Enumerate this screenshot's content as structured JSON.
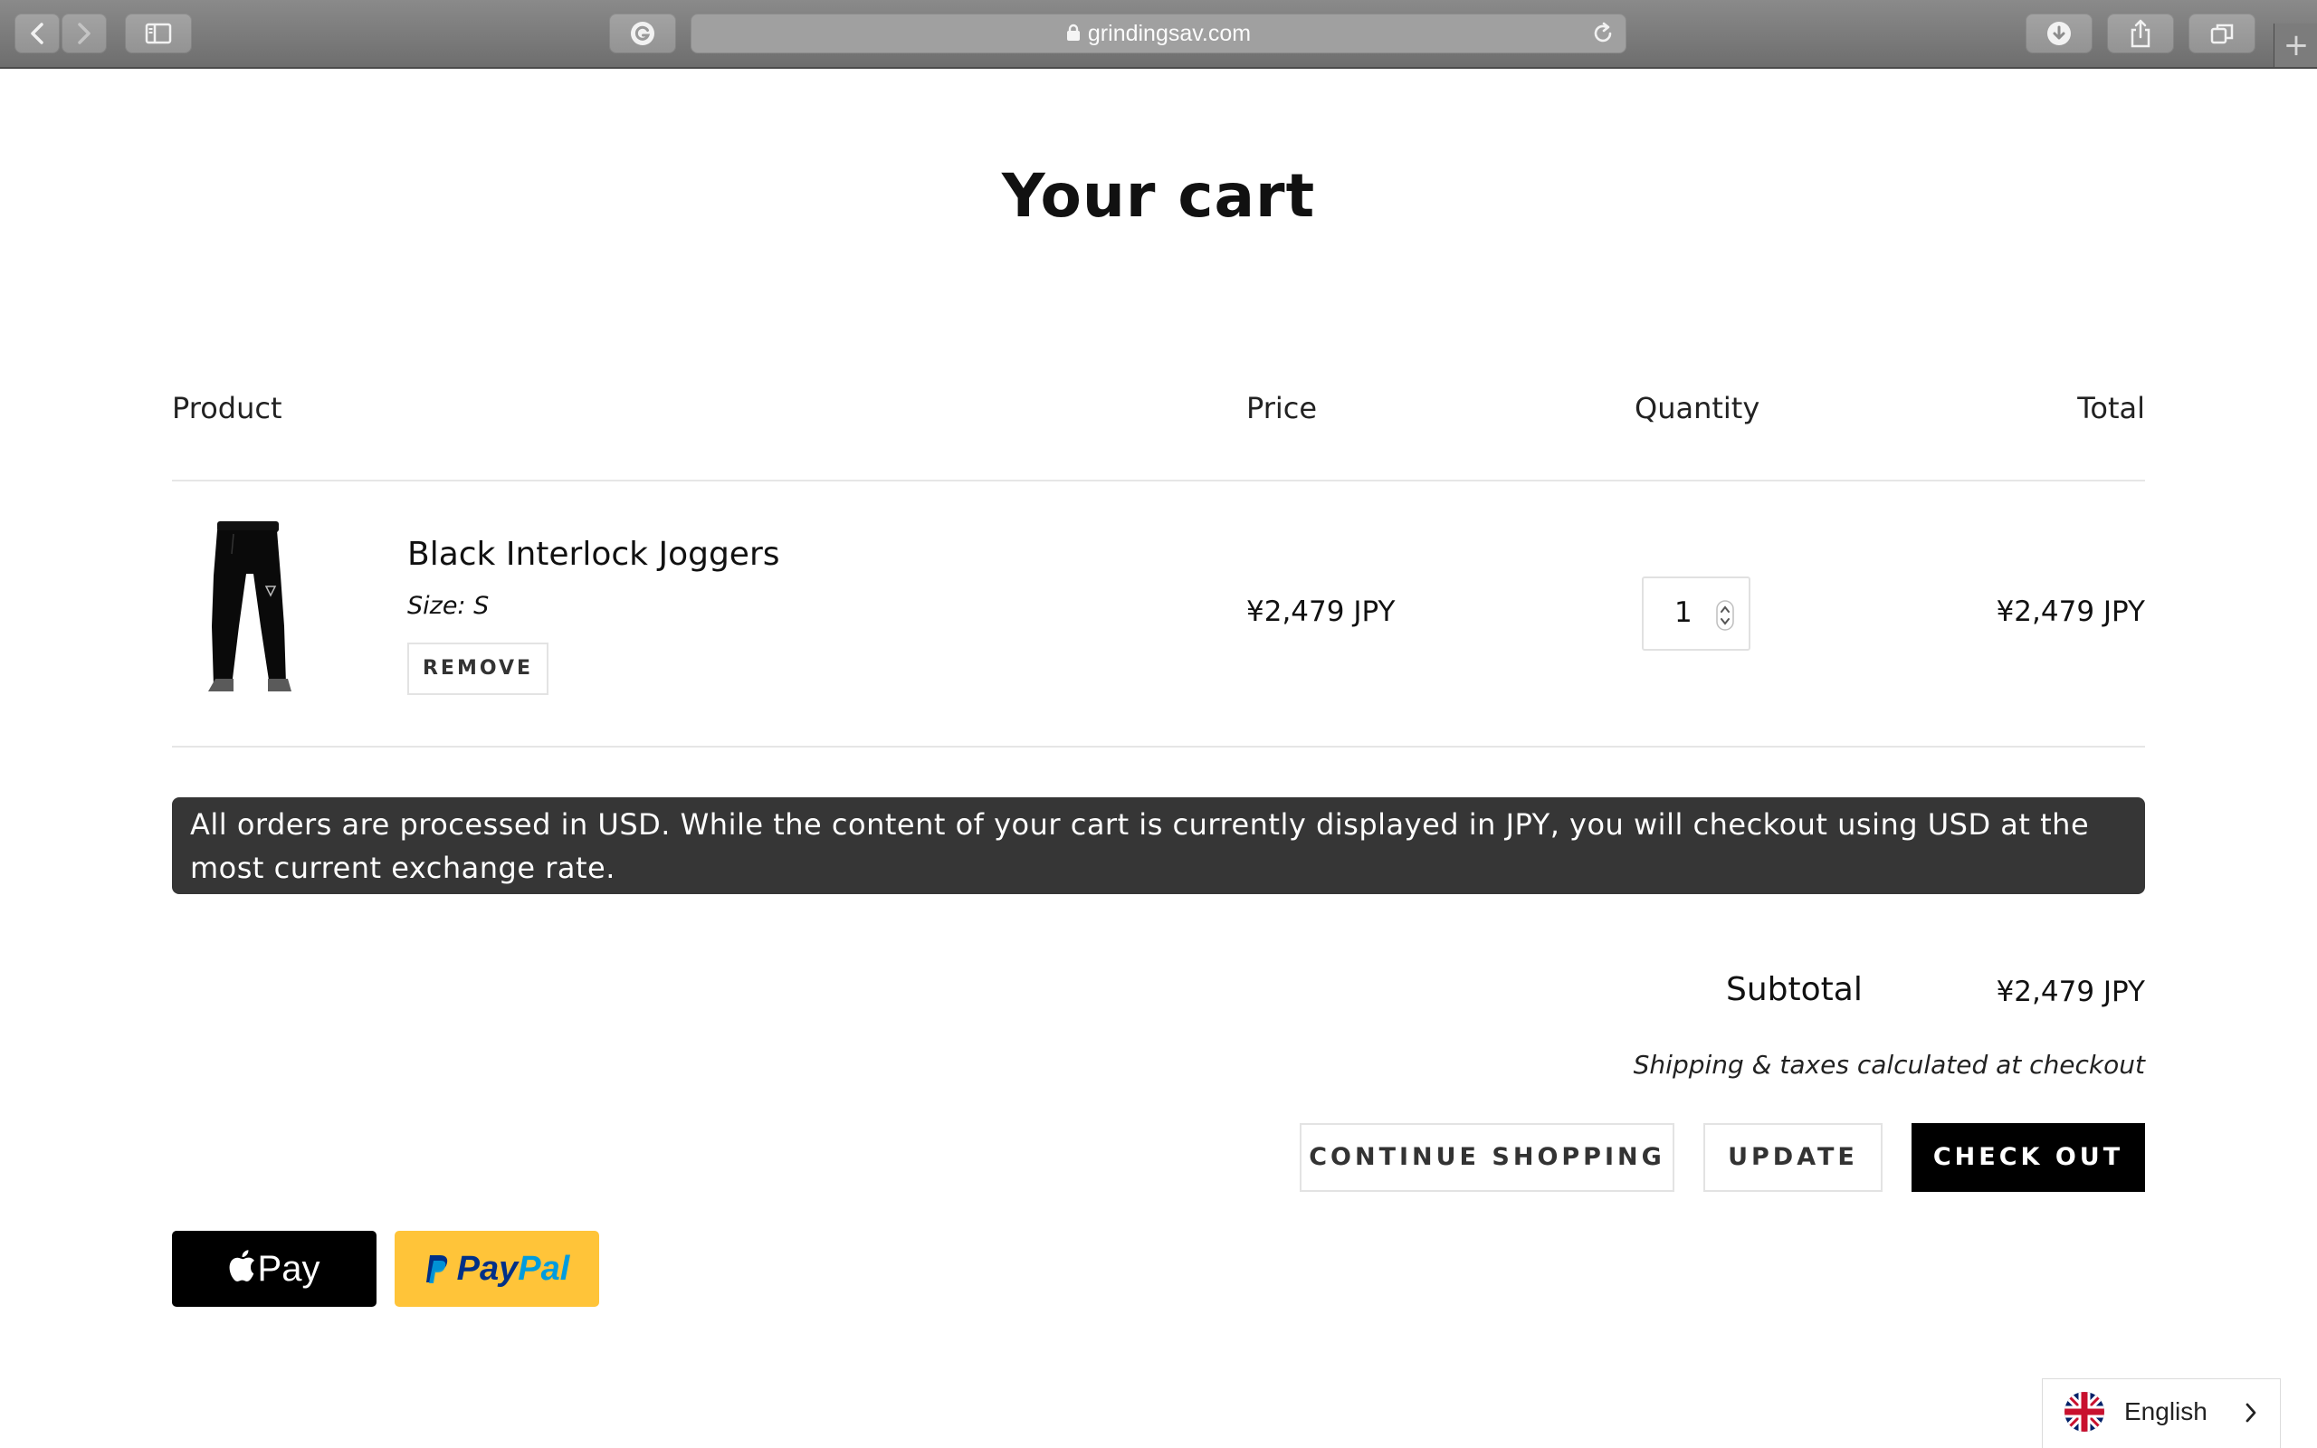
{
  "browser": {
    "url": "grindingsav.com",
    "grammarly_icon": "grammarly-icon",
    "new_tab_glyph": "+"
  },
  "page": {
    "title": "Your cart"
  },
  "table": {
    "headers": {
      "product": "Product",
      "price": "Price",
      "quantity": "Quantity",
      "total": "Total"
    },
    "items": [
      {
        "name": "Black Interlock Joggers",
        "size": "Size: S",
        "remove_label": "REMOVE",
        "price": "¥2,479 JPY",
        "quantity": "1",
        "total": "¥2,479 JPY",
        "image_icon": "joggers-product-image"
      }
    ]
  },
  "notice": {
    "text": "All orders are processed in USD. While the content of your cart is currently displayed in JPY, you will checkout using USD at the most current exchange rate."
  },
  "summary": {
    "subtotal_label": "Subtotal",
    "subtotal_value": "¥2,479 JPY",
    "shipping_note": "Shipping & taxes calculated at checkout"
  },
  "actions": {
    "continue_label": "CONTINUE SHOPPING",
    "update_label": "UPDATE",
    "checkout_label": "CHECK OUT"
  },
  "express": {
    "apple_pay_label": "Pay",
    "paypal_part1": "Pay",
    "paypal_part2": "Pal"
  },
  "language": {
    "label": "English",
    "flag_icon": "uk-flag-icon"
  },
  "colors": {
    "notice_bg": "#363636",
    "checkout_bg": "#000000",
    "paypal_bg": "#ffc439",
    "paypal_dark": "#003087",
    "paypal_light": "#009cde"
  }
}
